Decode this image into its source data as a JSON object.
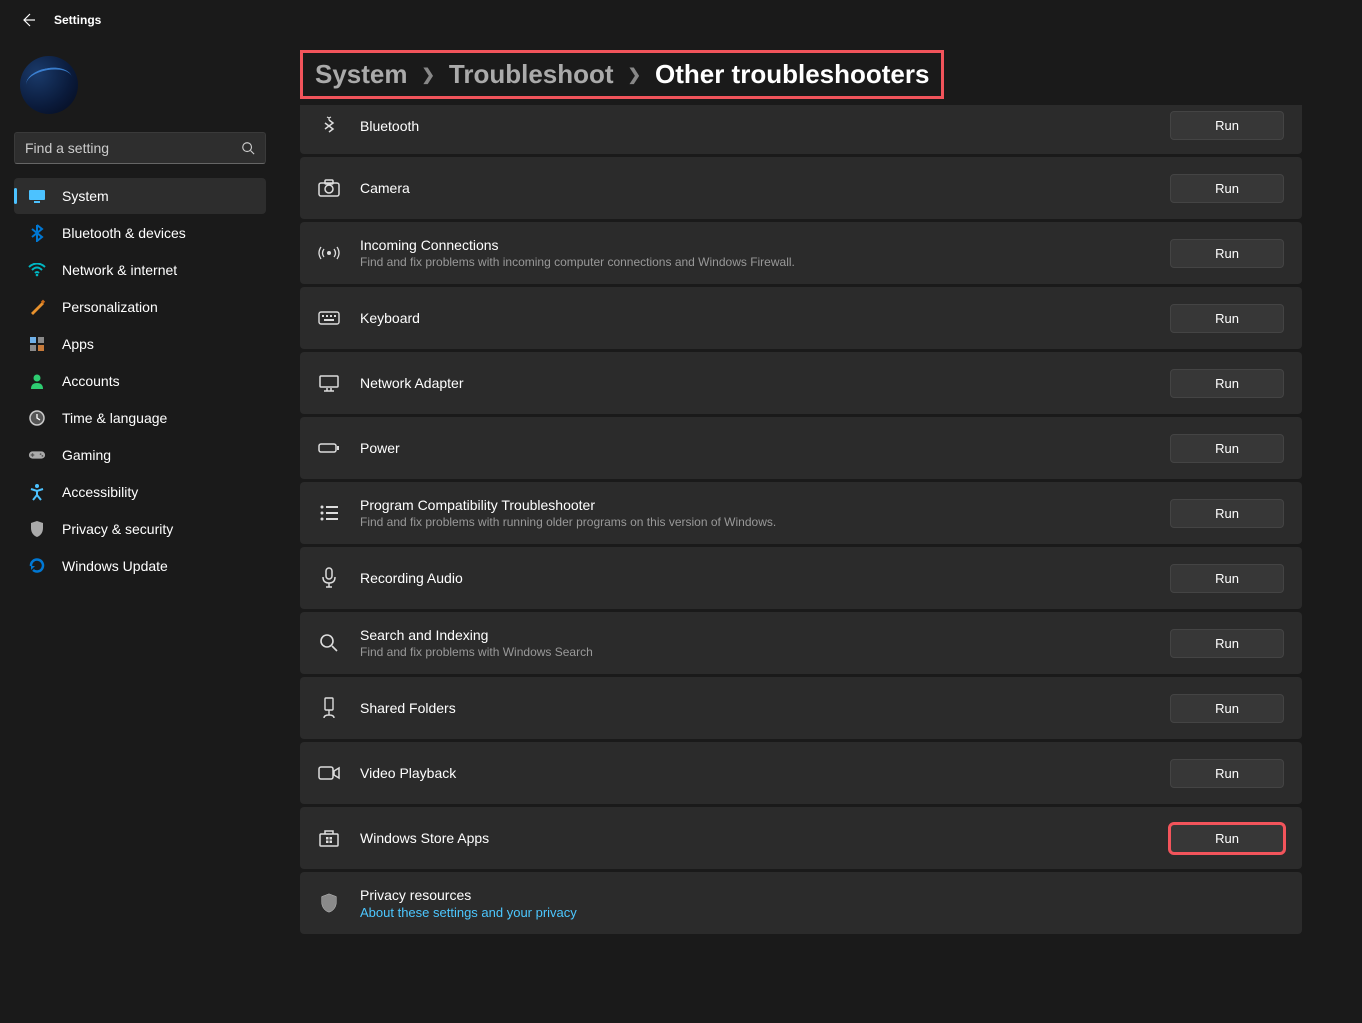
{
  "header": {
    "title": "Settings"
  },
  "search": {
    "placeholder": "Find a setting"
  },
  "sidebar": {
    "items": [
      {
        "label": "System",
        "icon": "system",
        "color": "#4cc2ff",
        "active": true
      },
      {
        "label": "Bluetooth & devices",
        "icon": "bluetooth",
        "color": "#0078d4"
      },
      {
        "label": "Network & internet",
        "icon": "wifi",
        "color": "#00b7c3"
      },
      {
        "label": "Personalization",
        "icon": "brush",
        "color": "#e8912d"
      },
      {
        "label": "Apps",
        "icon": "apps",
        "color": "#8a8a8a"
      },
      {
        "label": "Accounts",
        "icon": "person",
        "color": "#2ecc71"
      },
      {
        "label": "Time & language",
        "icon": "clock",
        "color": "#ccc"
      },
      {
        "label": "Gaming",
        "icon": "gamepad",
        "color": "#aaa"
      },
      {
        "label": "Accessibility",
        "icon": "accessibility",
        "color": "#4cc2ff"
      },
      {
        "label": "Privacy & security",
        "icon": "shield",
        "color": "#aaa"
      },
      {
        "label": "Windows Update",
        "icon": "update",
        "color": "#0078d4"
      }
    ]
  },
  "breadcrumb": {
    "a": "System",
    "b": "Troubleshoot",
    "c": "Other troubleshooters"
  },
  "runLabel": "Run",
  "troubleshooters": [
    {
      "title": "Bluetooth",
      "desc": "",
      "icon": "bluetooth-run",
      "first": true
    },
    {
      "title": "Camera",
      "desc": "",
      "icon": "camera"
    },
    {
      "title": "Incoming Connections",
      "desc": "Find and fix problems with incoming computer connections and Windows Firewall.",
      "icon": "signal"
    },
    {
      "title": "Keyboard",
      "desc": "",
      "icon": "keyboard"
    },
    {
      "title": "Network Adapter",
      "desc": "",
      "icon": "monitor"
    },
    {
      "title": "Power",
      "desc": "",
      "icon": "battery"
    },
    {
      "title": "Program Compatibility Troubleshooter",
      "desc": "Find and fix problems with running older programs on this version of Windows.",
      "icon": "list"
    },
    {
      "title": "Recording Audio",
      "desc": "",
      "icon": "mic"
    },
    {
      "title": "Search and Indexing",
      "desc": "Find and fix problems with Windows Search",
      "icon": "search"
    },
    {
      "title": "Shared Folders",
      "desc": "",
      "icon": "shared"
    },
    {
      "title": "Video Playback",
      "desc": "",
      "icon": "video"
    },
    {
      "title": "Windows Store Apps",
      "desc": "",
      "icon": "store",
      "highlight": true
    }
  ],
  "privacy": {
    "title": "Privacy resources",
    "link": "About these settings and your privacy"
  }
}
